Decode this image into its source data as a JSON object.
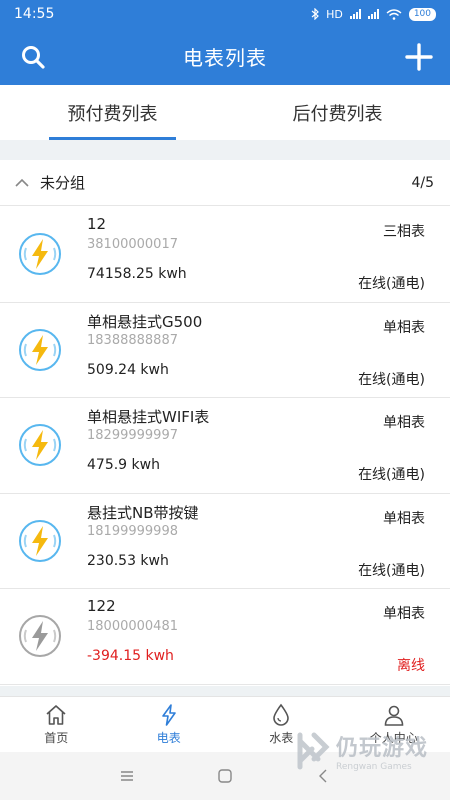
{
  "status_bar": {
    "time": "14:55",
    "network": "HD",
    "battery": "100"
  },
  "header": {
    "title": "电表列表"
  },
  "tabs": [
    {
      "label": "预付费列表",
      "active": true
    },
    {
      "label": "后付费列表",
      "active": false
    }
  ],
  "group": {
    "name": "未分组",
    "count": "4/5"
  },
  "meters": [
    {
      "name": "12",
      "serial": "38100000017",
      "reading": "74158.25 kwh",
      "type": "三相表",
      "status": "在线(通电)",
      "online": true
    },
    {
      "name": "单相悬挂式G500",
      "serial": "18388888887",
      "reading": "509.24 kwh",
      "type": "单相表",
      "status": "在线(通电)",
      "online": true
    },
    {
      "name": "单相悬挂式WIFI表",
      "serial": "18299999997",
      "reading": "475.9 kwh",
      "type": "单相表",
      "status": "在线(通电)",
      "online": true
    },
    {
      "name": "悬挂式NB带按键",
      "serial": "18199999998",
      "reading": "230.53 kwh",
      "type": "单相表",
      "status": "在线(通电)",
      "online": true
    },
    {
      "name": "122",
      "serial": "18000000481",
      "reading": "-394.15 kwh",
      "type": "单相表",
      "status": "离线",
      "online": false
    }
  ],
  "bottom_nav": [
    {
      "label": "首页",
      "icon": "home-icon",
      "active": false
    },
    {
      "label": "电表",
      "icon": "lightning-icon",
      "active": true
    },
    {
      "label": "水表",
      "icon": "water-drop-icon",
      "active": false
    },
    {
      "label": "个人中心",
      "icon": "person-icon",
      "active": false
    }
  ],
  "watermark": {
    "cn": "仍玩游戏",
    "en": "Rengwan Games"
  },
  "colors": {
    "primary": "#2f7ed8",
    "offline": "#e02020",
    "bolt": "#f5b90f",
    "ring_online": "#58b7ef",
    "ring_offline": "#a7a7a7"
  }
}
